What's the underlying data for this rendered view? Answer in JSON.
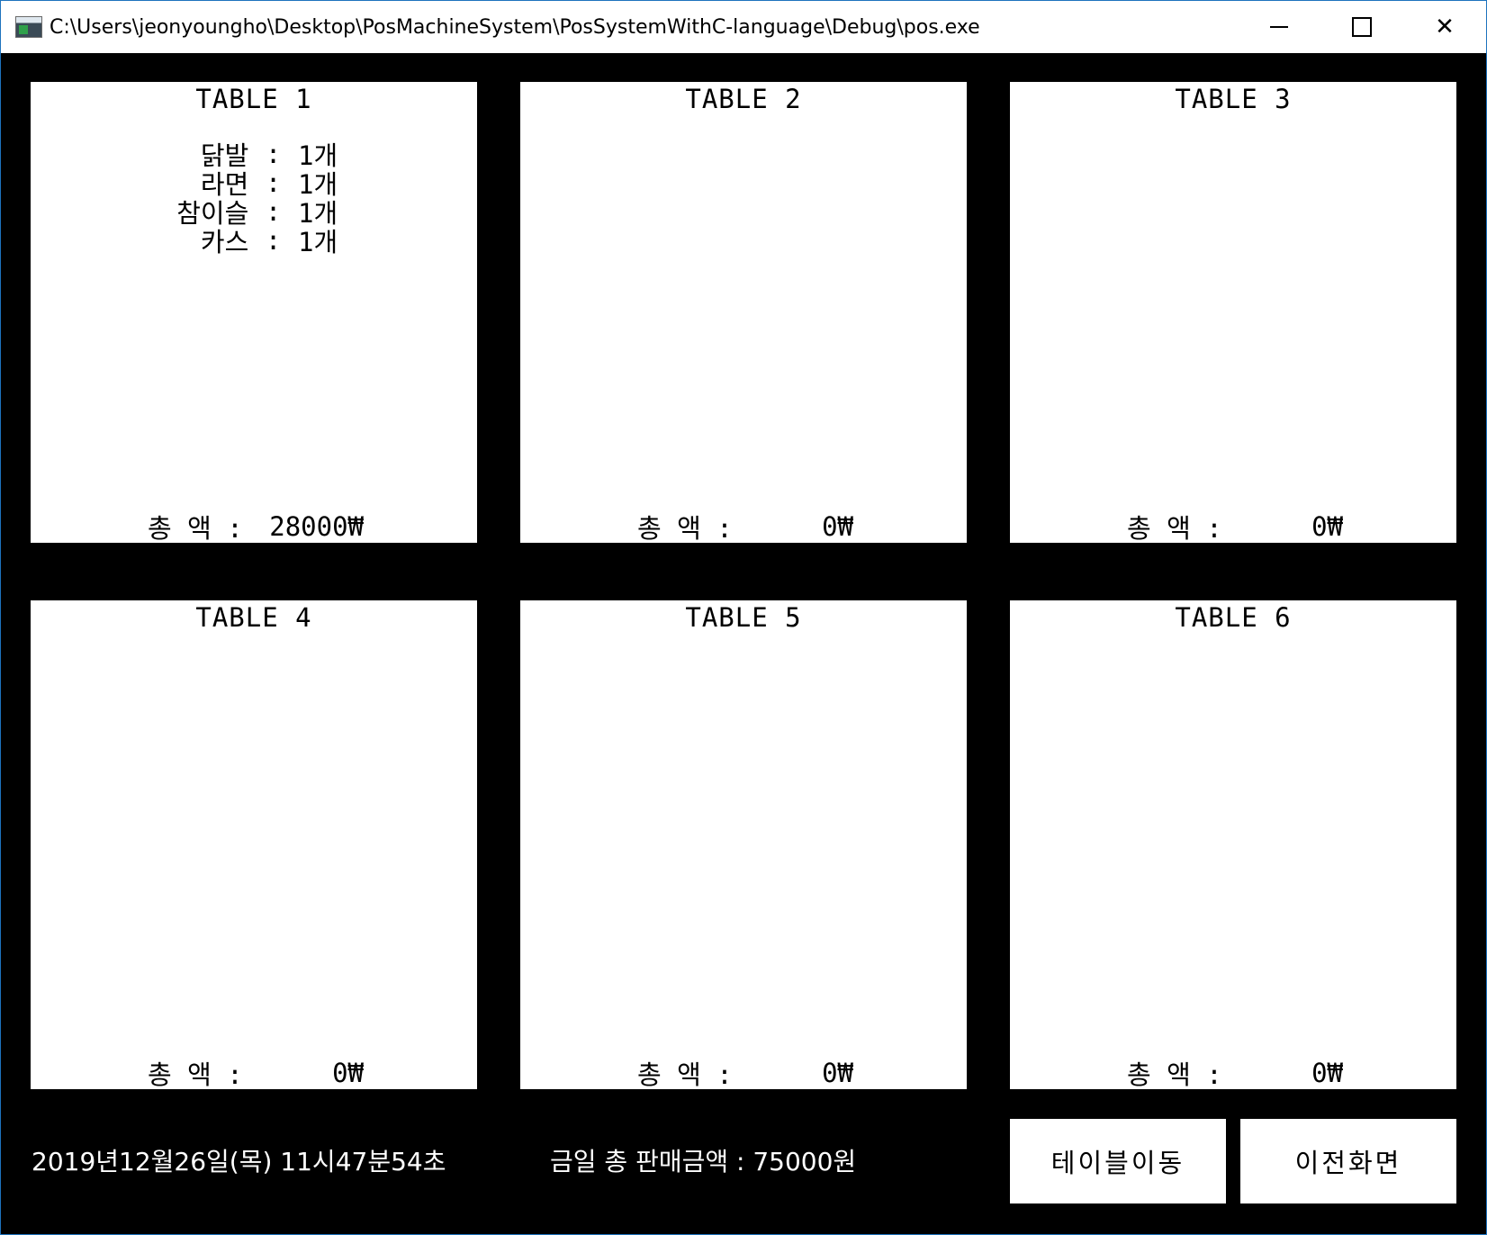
{
  "window": {
    "title": "C:\\Users\\jeonyoungho\\Desktop\\PosMachineSystem\\PosSystemWithC-language\\Debug\\pos.exe",
    "controls": {
      "minimize": "",
      "maximize": "",
      "close": "✕"
    }
  },
  "tables": [
    {
      "title": "TABLE  1",
      "items": [
        {
          "name": "닭발",
          "colon": ":",
          "qty": "1개"
        },
        {
          "name": "라면",
          "colon": ":",
          "qty": "1개"
        },
        {
          "name": "참이슬",
          "colon": ":",
          "qty": "1개"
        },
        {
          "name": "카스",
          "colon": ":",
          "qty": "1개"
        }
      ],
      "total_label": "총  액  :",
      "total_value": "28000₩"
    },
    {
      "title": "TABLE  2",
      "items": [],
      "total_label": "총  액  :",
      "total_value": "0₩"
    },
    {
      "title": "TABLE  3",
      "items": [],
      "total_label": "총  액  :",
      "total_value": "0₩"
    },
    {
      "title": "TABLE  4",
      "items": [],
      "total_label": "총  액  :",
      "total_value": "0₩"
    },
    {
      "title": "TABLE  5",
      "items": [],
      "total_label": "총  액  :",
      "total_value": "0₩"
    },
    {
      "title": "TABLE  6",
      "items": [],
      "total_label": "총  액  :",
      "total_value": "0₩"
    }
  ],
  "footer": {
    "datetime": "2019년12월26일(목) 11시47분54초",
    "daily_sales": "금일 총 판매금액 : 75000원",
    "move_table_label": "테이블이동",
    "previous_screen_label": "이전화면"
  },
  "colors": {
    "background": "#000000",
    "panel": "#ffffff",
    "border": "#1e73be"
  }
}
